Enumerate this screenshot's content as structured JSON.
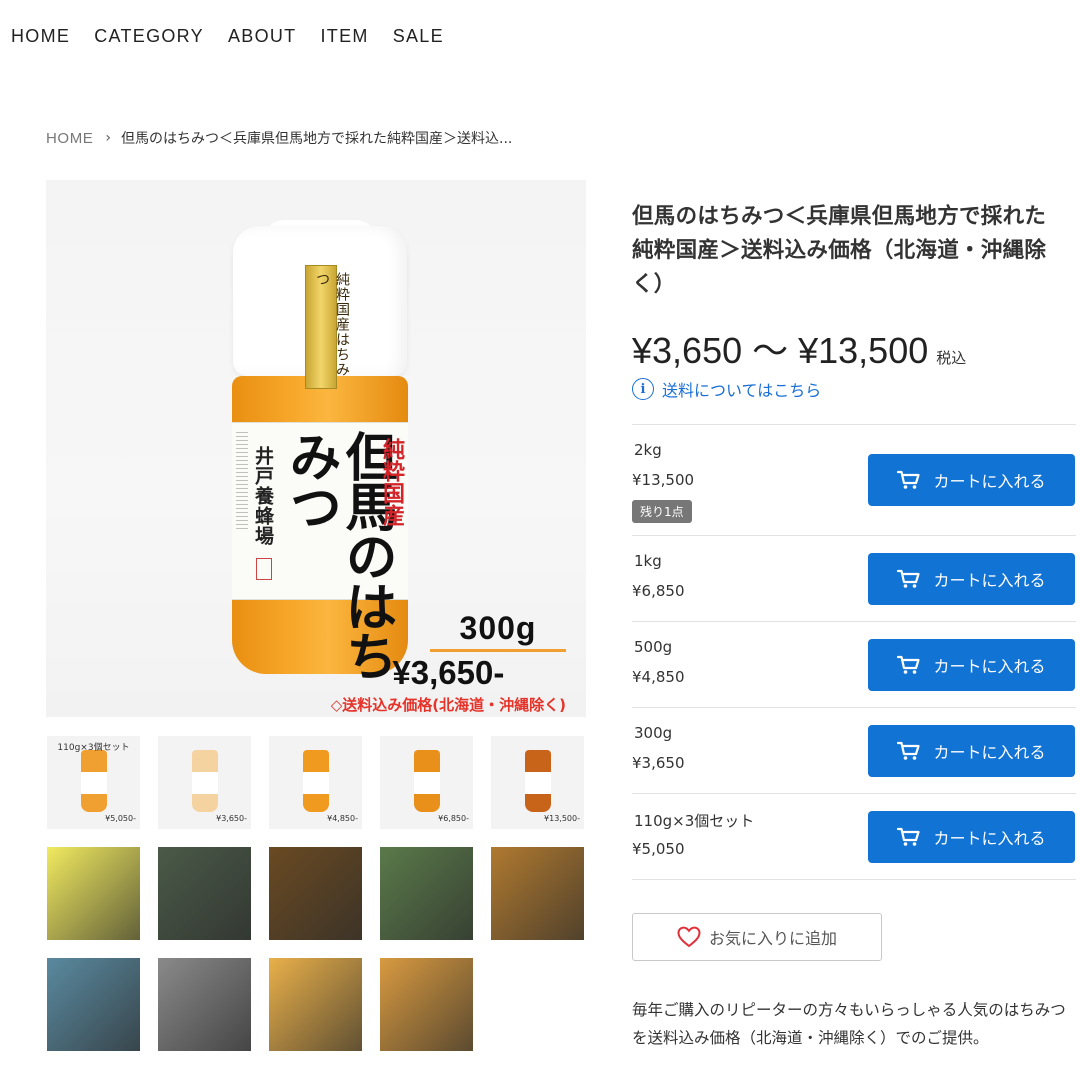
{
  "nav": [
    {
      "label": "HOME"
    },
    {
      "label": "CATEGORY"
    },
    {
      "label": "ABOUT"
    },
    {
      "label": "ITEM"
    },
    {
      "label": "SALE"
    }
  ],
  "breadcrumb": {
    "home": "HOME",
    "current": "但馬のはちみつ＜兵庫県但馬地方で採れた純粋国産＞送料込..."
  },
  "main_image": {
    "seal_text": "純粋国産はちみつ",
    "title": "但馬のはちみつ",
    "red_label": "純粋国産",
    "maker": "井戸養蜂場",
    "weight": "300g",
    "price": "¥3,650-",
    "note": "◇送料込み価格(北海道・沖縄除く)"
  },
  "thumbnails": [
    {
      "caption": "110g×3個セット",
      "price": "¥5,050-",
      "color": "#f0a030"
    },
    {
      "caption": "",
      "price": "¥3,650-",
      "color": "#f5d3a0"
    },
    {
      "caption": "",
      "price": "¥4,850-",
      "color": "#f09a20"
    },
    {
      "caption": "",
      "price": "¥6,850-",
      "color": "#e8901a"
    },
    {
      "caption": "",
      "price": "¥13,500-",
      "color": "#c8631a"
    },
    {
      "caption": "",
      "price": "",
      "color": "#f1ea60"
    },
    {
      "caption": "",
      "price": "",
      "color": "#4a5a48"
    },
    {
      "caption": "",
      "price": "",
      "color": "#6a4a22"
    },
    {
      "caption": "",
      "price": "",
      "color": "#5a7a4a"
    },
    {
      "caption": "",
      "price": "",
      "color": "#b07a30"
    },
    {
      "caption": "",
      "price": "",
      "color": "#5a8aa0"
    },
    {
      "caption": "",
      "price": "",
      "color": "#8a8a8a"
    },
    {
      "caption": "",
      "price": "",
      "color": "#e9b04a"
    },
    {
      "caption": "",
      "price": "",
      "color": "#d89a40"
    }
  ],
  "product": {
    "title": "但馬のはちみつ＜兵庫県但馬地方で採れた純粋国産＞送料込み価格（北海道・沖縄除く）",
    "price_range": "¥3,650 〜 ¥13,500",
    "tax_label": "税込",
    "shipping_link": "送料についてはこちら"
  },
  "variants": [
    {
      "name": "2kg",
      "price": "¥13,500",
      "badge": "残り1点",
      "button": "カートに入れる"
    },
    {
      "name": "1kg",
      "price": "¥6,850",
      "badge": "",
      "button": "カートに入れる"
    },
    {
      "name": "500g",
      "price": "¥4,850",
      "badge": "",
      "button": "カートに入れる"
    },
    {
      "name": "300g",
      "price": "¥3,650",
      "badge": "",
      "button": "カートに入れる"
    },
    {
      "name": "110g×3個セット",
      "price": "¥5,050",
      "badge": "",
      "button": "カートに入れる"
    }
  ],
  "favorite": {
    "label": "お気に入りに追加"
  },
  "description": "毎年ご購入のリピーターの方々もいらっしゃる人気のはちみつを送料込み価格（北海道・沖縄除く）でのご提供。",
  "colors": {
    "accent_blue": "#1173d4",
    "link_blue": "#1a6fd6",
    "badge_gray": "#777777",
    "heart_red": "#e0303a",
    "price_note_red": "#e5332a",
    "honey": "#f7a82b"
  }
}
